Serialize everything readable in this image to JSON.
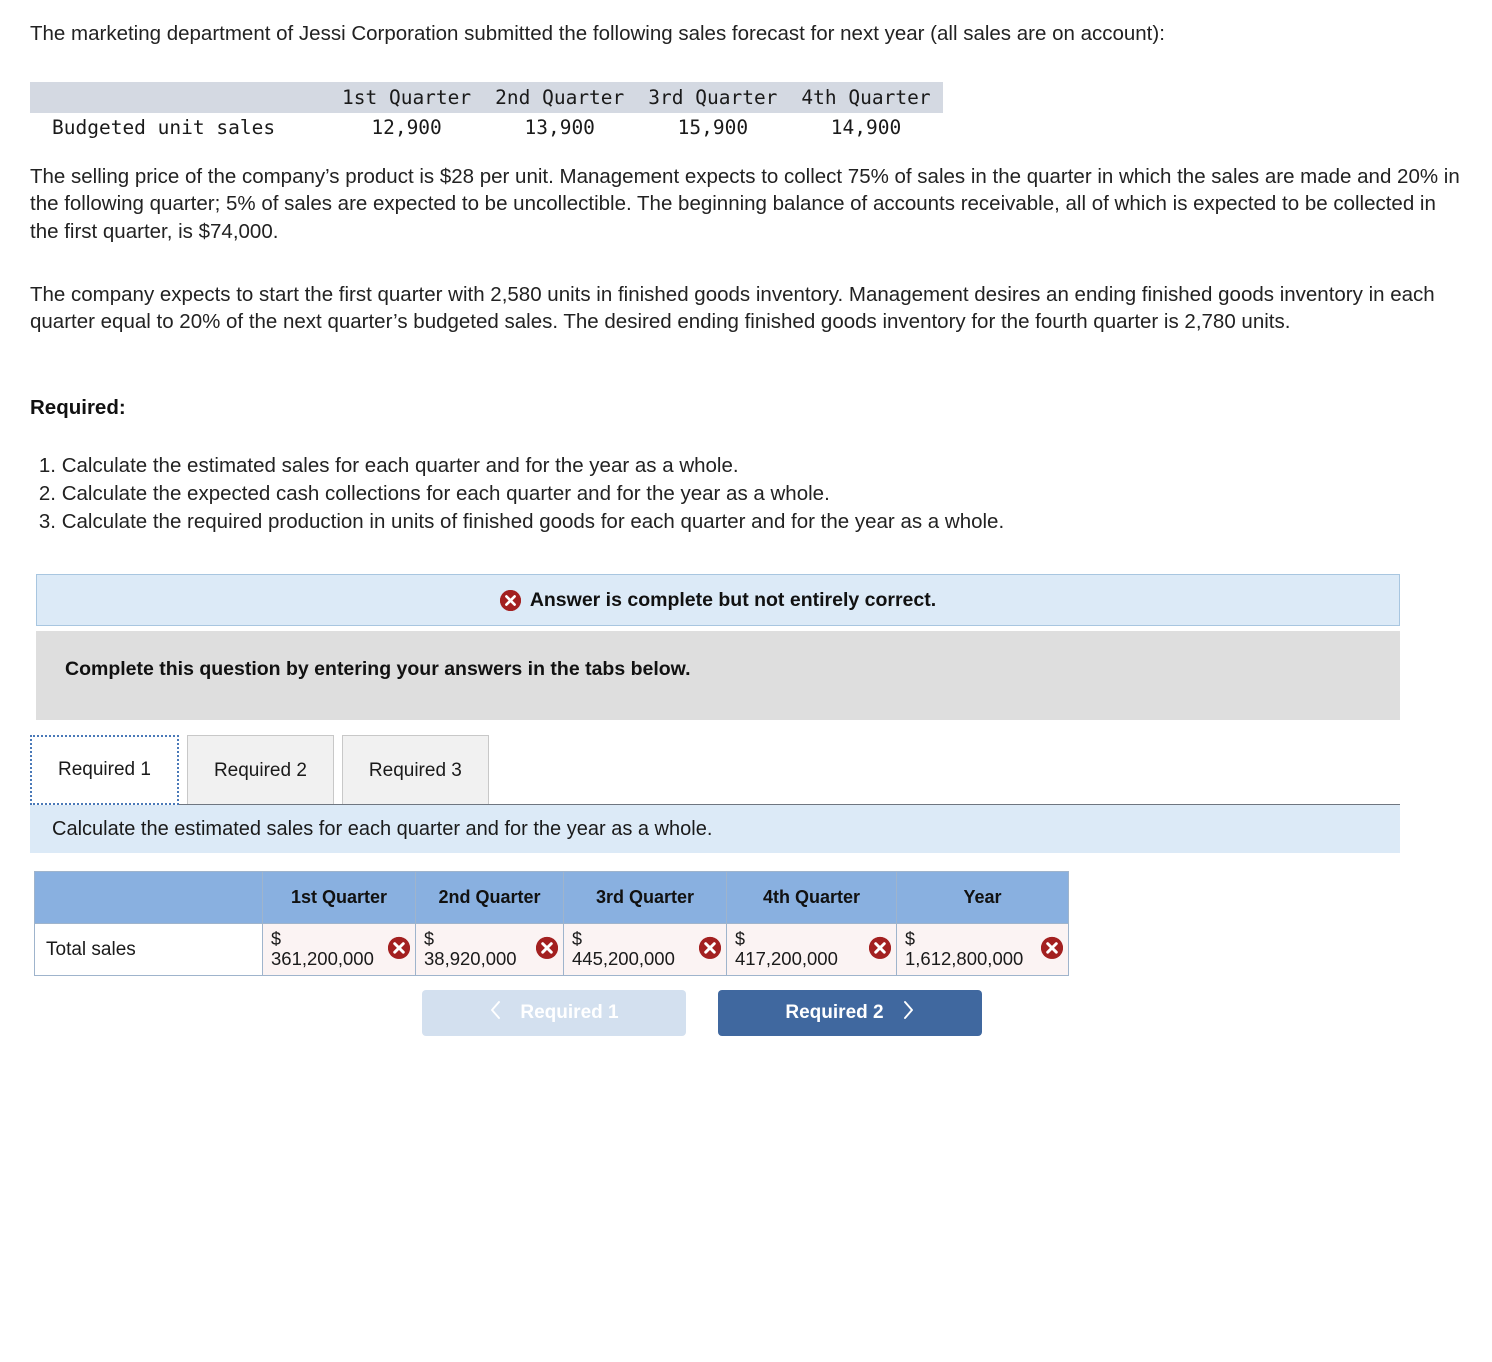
{
  "problem": {
    "intro": "The marketing department of Jessi Corporation submitted the following sales forecast for next year (all sales are on account):",
    "paragraph1": "The selling price of the company’s product is $28 per unit. Management expects to collect 75% of sales in the quarter in which the sales are made and 20% in the following quarter; 5% of sales are expected to be uncollectible. The beginning balance of accounts receivable, all of which is expected to be collected in the first quarter, is $74,000.",
    "paragraph2": "The company expects to start the first quarter with 2,580 units in finished goods inventory. Management desires an ending finished goods inventory in each quarter equal to 20% of the next quarter’s budgeted sales. The desired ending finished goods inventory for the fourth quarter is 2,780 units.",
    "required_heading": "Required:",
    "requirements": [
      {
        "num": "1.",
        "text": "Calculate the estimated sales for each quarter and for the year as a whole."
      },
      {
        "num": "2.",
        "text": "Calculate the expected cash collections for each quarter and for the year as a whole."
      },
      {
        "num": "3.",
        "text": "Calculate the required production in units of finished goods for each quarter and for the year as a whole."
      }
    ]
  },
  "budget_table": {
    "corner": "",
    "headers": [
      "1st Quarter",
      "2nd Quarter",
      "3rd Quarter",
      "4th Quarter"
    ],
    "row_label": "Budgeted unit sales",
    "values": [
      "12,900",
      "13,900",
      "15,900",
      "14,900"
    ]
  },
  "status": {
    "icon": "x-circle-icon",
    "message": "Answer is complete but not entirely correct."
  },
  "instruction": {
    "text": "Complete this question by entering your answers in the tabs below."
  },
  "tabs": [
    {
      "label": "Required 1",
      "active": true
    },
    {
      "label": "Required 2",
      "active": false
    },
    {
      "label": "Required 3",
      "active": false
    }
  ],
  "task": {
    "description": "Calculate the estimated sales for each quarter and for the year as a whole."
  },
  "answer_table": {
    "corner": "",
    "headers": [
      "1st Quarter",
      "2nd Quarter",
      "3rd Quarter",
      "4th Quarter",
      "Year"
    ],
    "rows": [
      {
        "label": "Total sales",
        "cells": [
          {
            "currency": "$",
            "amount": "361,200,000",
            "status": "incorrect"
          },
          {
            "currency": "$",
            "amount": "38,920,000",
            "status": "incorrect"
          },
          {
            "currency": "$",
            "amount": "445,200,000",
            "status": "incorrect"
          },
          {
            "currency": "$",
            "amount": "417,200,000",
            "status": "incorrect"
          },
          {
            "currency": "$",
            "amount": "1,612,800,000",
            "status": "incorrect"
          }
        ]
      }
    ]
  },
  "navigation": {
    "prev": {
      "label": "Required 1",
      "icon": "chevron-left-icon",
      "disabled": true
    },
    "next": {
      "label": "Required 2",
      "icon": "chevron-right-icon",
      "disabled": false
    }
  },
  "colors": {
    "banner_bg": "#dceaf7",
    "banner_border": "#a8c6e0",
    "instruction_bg": "#dedede",
    "table_header_bg": "#89b0e0",
    "cell_bg": "#fbf3f3",
    "error_red": "#a32020",
    "next_button": "#40689f",
    "prev_button": "#d3e0ef",
    "budget_header_bg": "#d4d9e2"
  }
}
